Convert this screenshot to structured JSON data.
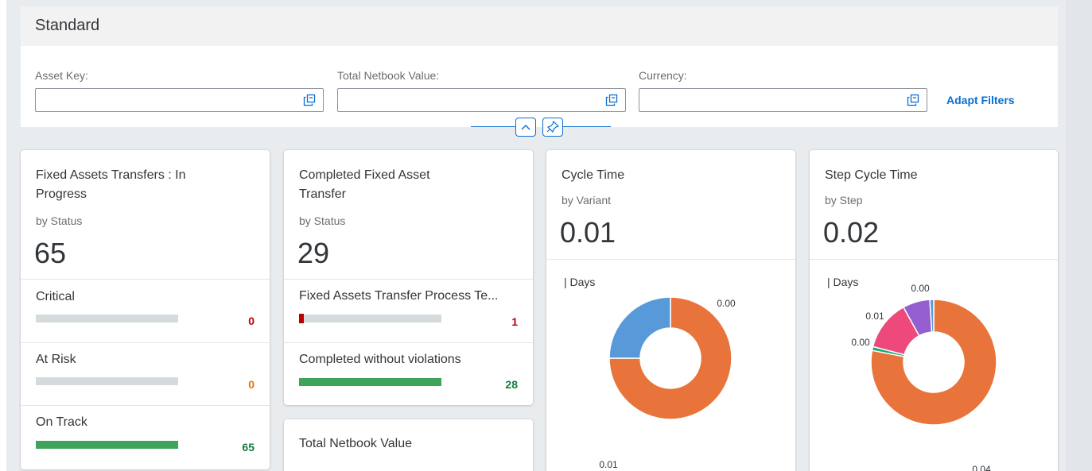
{
  "header": {
    "title": "Standard"
  },
  "filters": [
    {
      "label": "Asset Key:",
      "value": ""
    },
    {
      "label": "Total Netbook Value:",
      "value": ""
    },
    {
      "label": "Currency:",
      "value": ""
    }
  ],
  "adapt_filters_label": "Adapt Filters",
  "colors": {
    "critical": "#bb0000",
    "at_risk": "#e9730c",
    "good": "#107e3e",
    "bar_good": "#3fa45b",
    "bar_bg": "#d5dadd",
    "link": "#0a6ed1"
  },
  "cards": [
    {
      "title_line1": "Fixed Assets Transfers : In",
      "title_line2": "Progress",
      "subtitle": "by Status",
      "kpi": "65",
      "items": [
        {
          "label": "Critical",
          "value": "0",
          "fraction": 0,
          "color": "#bb0000"
        },
        {
          "label": "At Risk",
          "value": "0",
          "fraction": 0,
          "color": "#e9730c"
        },
        {
          "label": "On Track",
          "value": "65",
          "fraction": 1.0,
          "color": "#107e3e"
        }
      ]
    },
    {
      "title_line1": "Completed Fixed Asset",
      "title_line2": "Transfer",
      "subtitle": "by Status",
      "kpi": "29",
      "items": [
        {
          "label": "Fixed Assets Transfer Process Te...",
          "value": "1",
          "fraction": 0.036,
          "color": "#bb0000"
        },
        {
          "label": "Completed without violations",
          "value": "28",
          "fraction": 1.0,
          "color": "#107e3e"
        }
      ]
    },
    {
      "title": "Total Netbook Value"
    },
    {
      "title": "Cycle Time",
      "subtitle": "by Variant",
      "kpi": "0.01",
      "unit": "| Days"
    },
    {
      "title": "Step Cycle Time",
      "subtitle": "by Step",
      "kpi": "0.02",
      "unit": "| Days"
    }
  ],
  "chart_data": [
    {
      "type": "pie",
      "donut": true,
      "values": [
        0.75,
        0.25
      ],
      "colors": [
        "#e8743b",
        "#5899da"
      ],
      "data_labels": [
        "0.01",
        "0.00"
      ]
    },
    {
      "type": "pie",
      "donut": true,
      "values": [
        0.78,
        0.01,
        0.13,
        0.07,
        0.01
      ],
      "colors": [
        "#e8743b",
        "#19a979",
        "#ed4a7b",
        "#945ecf",
        "#5899da"
      ],
      "data_labels": [
        "0.04",
        "0.00",
        "0.01",
        "0.00"
      ]
    }
  ]
}
